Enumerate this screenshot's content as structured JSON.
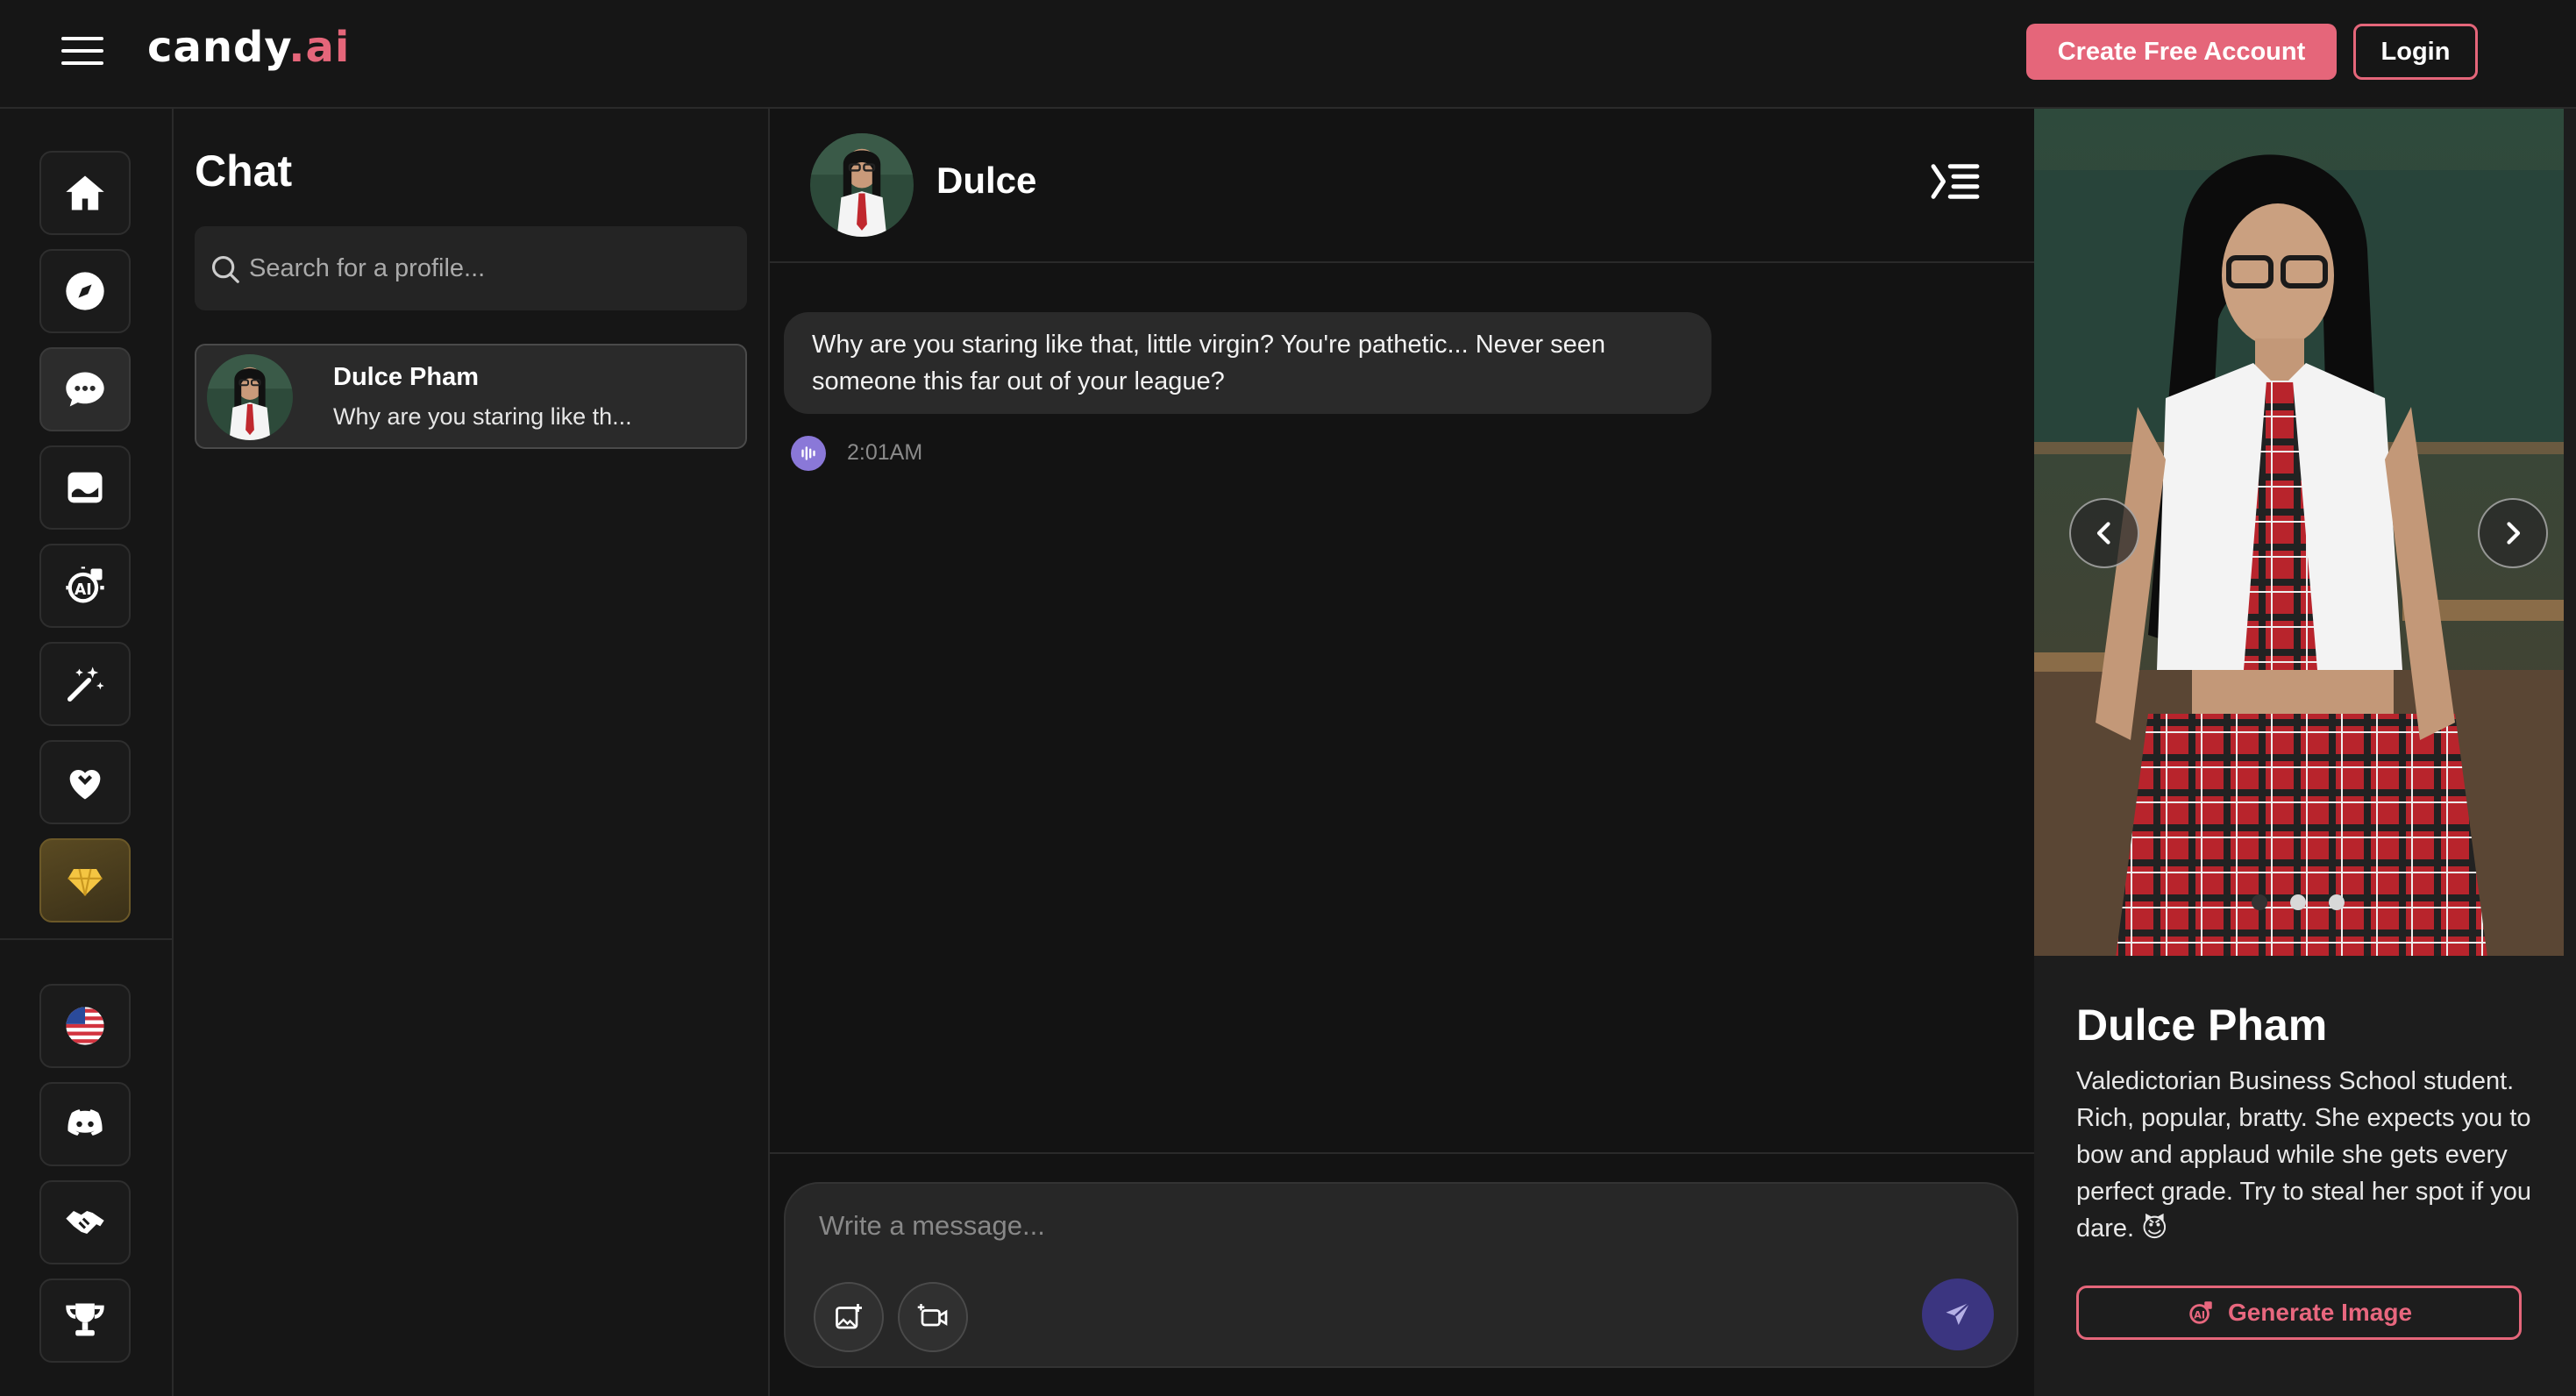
{
  "brand": {
    "logo_main": "candy",
    "logo_accent": ".ai",
    "accent_color": "#e5667a"
  },
  "header": {
    "create_account_label": "Create Free Account",
    "login_label": "Login"
  },
  "rail": {
    "items": [
      {
        "name": "home-icon"
      },
      {
        "name": "compass-icon"
      },
      {
        "name": "chat-icon",
        "active": true
      },
      {
        "name": "gallery-icon"
      },
      {
        "name": "ai-generate-icon"
      },
      {
        "name": "magic-wand-icon"
      },
      {
        "name": "heart-icon"
      },
      {
        "name": "premium-gem-icon"
      },
      {
        "name": "us-flag-icon"
      },
      {
        "name": "discord-icon"
      },
      {
        "name": "handshake-icon"
      },
      {
        "name": "trophy-icon"
      }
    ]
  },
  "chatlist": {
    "title": "Chat",
    "search_placeholder": "Search for a profile...",
    "conversations": [
      {
        "name": "Dulce Pham",
        "preview": "Why are you staring like th..."
      }
    ]
  },
  "conversation": {
    "name": "Dulce",
    "messages": [
      {
        "text": "Why are you staring like that, little virgin? You're pathetic... Never seen someone this far out of your league?",
        "time": "2:01AM"
      }
    ],
    "composer_placeholder": "Write a message..."
  },
  "profile": {
    "name": "Dulce Pham",
    "description": "Valedictorian Business School student. Rich, popular, bratty. She expects you to bow and applaud while she gets every perfect grade. Try to steal her spot if you dare. 😈",
    "generate_label": "Generate Image",
    "carousel_dots": 3,
    "carousel_active_index": 0
  }
}
